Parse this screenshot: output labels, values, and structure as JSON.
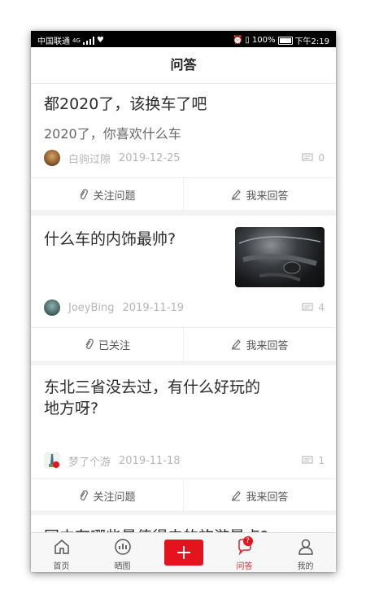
{
  "status_bar": {
    "carrier": "中国联通",
    "network": "4G",
    "battery_text": "100%",
    "time": "下午2:19"
  },
  "header": {
    "title": "问答"
  },
  "questions": [
    {
      "title": "都2020了，该换车了吧",
      "subtitle": "2020了，你喜欢什么车",
      "author": "白驹过隙",
      "date": "2019-12-25",
      "comments": "0",
      "follow_label": "关注问题",
      "answer_label": "我来回答"
    },
    {
      "title": "什么车的内饰最帅?",
      "author": "JoeyBing",
      "date": "2019-11-19",
      "comments": "4",
      "follow_label": "已关注",
      "answer_label": "我来回答",
      "thumbnail": "car-interior-image"
    },
    {
      "title_line1": "东北三省没去过，有什么好玩的",
      "title_line2": "地方呀?",
      "author": "梦了个游",
      "date": "2019-11-18",
      "comments": "1",
      "follow_label": "关注问题",
      "answer_label": "我来回答"
    },
    {
      "title_partial": "国内有哪些最值得去的旅游景点?"
    }
  ],
  "tabbar": {
    "items": [
      {
        "label": "首页",
        "icon": "home-icon"
      },
      {
        "label": "晒图",
        "icon": "chart-icon"
      },
      {
        "label": "",
        "icon": "plus-icon"
      },
      {
        "label": "问答",
        "icon": "question-icon",
        "badge": "?"
      },
      {
        "label": "我的",
        "icon": "user-icon"
      }
    ]
  },
  "colors": {
    "accent": "#e3141d",
    "active_tab": "#d6222a"
  }
}
